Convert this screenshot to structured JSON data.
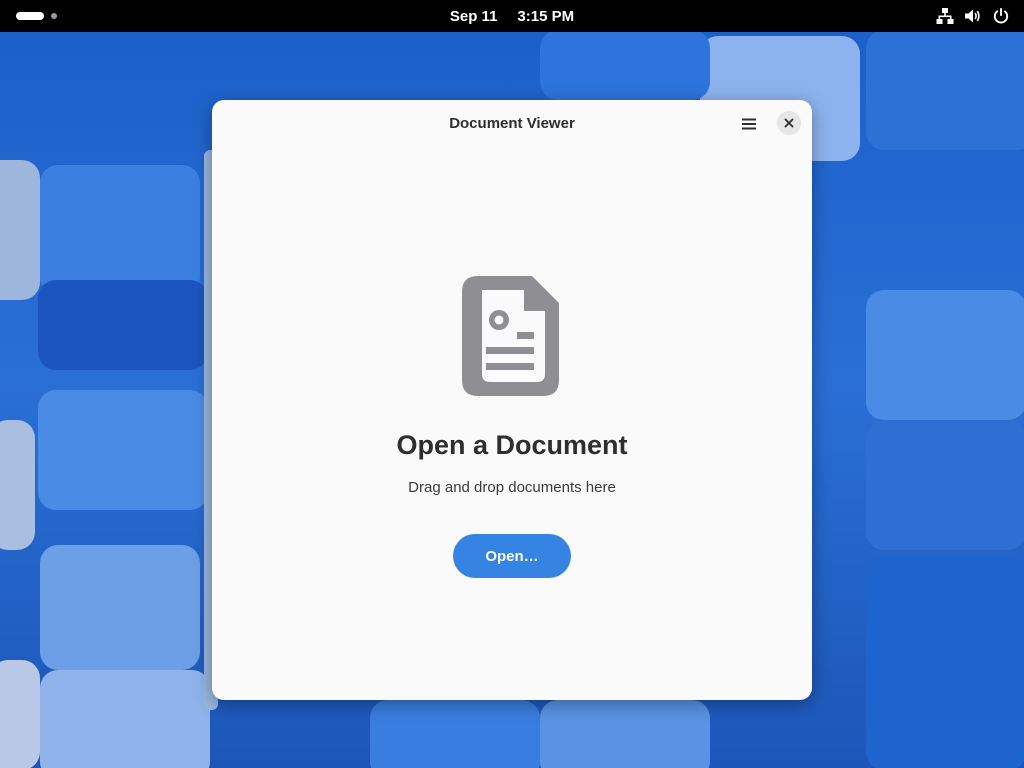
{
  "topbar": {
    "date": "Sep 11",
    "time": "3:15 PM",
    "tray_icons": [
      "network-icon",
      "volume-icon",
      "power-icon"
    ]
  },
  "window": {
    "title": "Document Viewer",
    "heading": "Open a Document",
    "subtext": "Drag and drop documents here",
    "open_button": "Open…",
    "icons": [
      "menu-icon",
      "close-icon",
      "document-icon"
    ]
  },
  "colors": {
    "accent": "#3584e4",
    "topbar": "#000000",
    "window_bg": "#fafafa",
    "icon_gray": "#8e8e93"
  }
}
